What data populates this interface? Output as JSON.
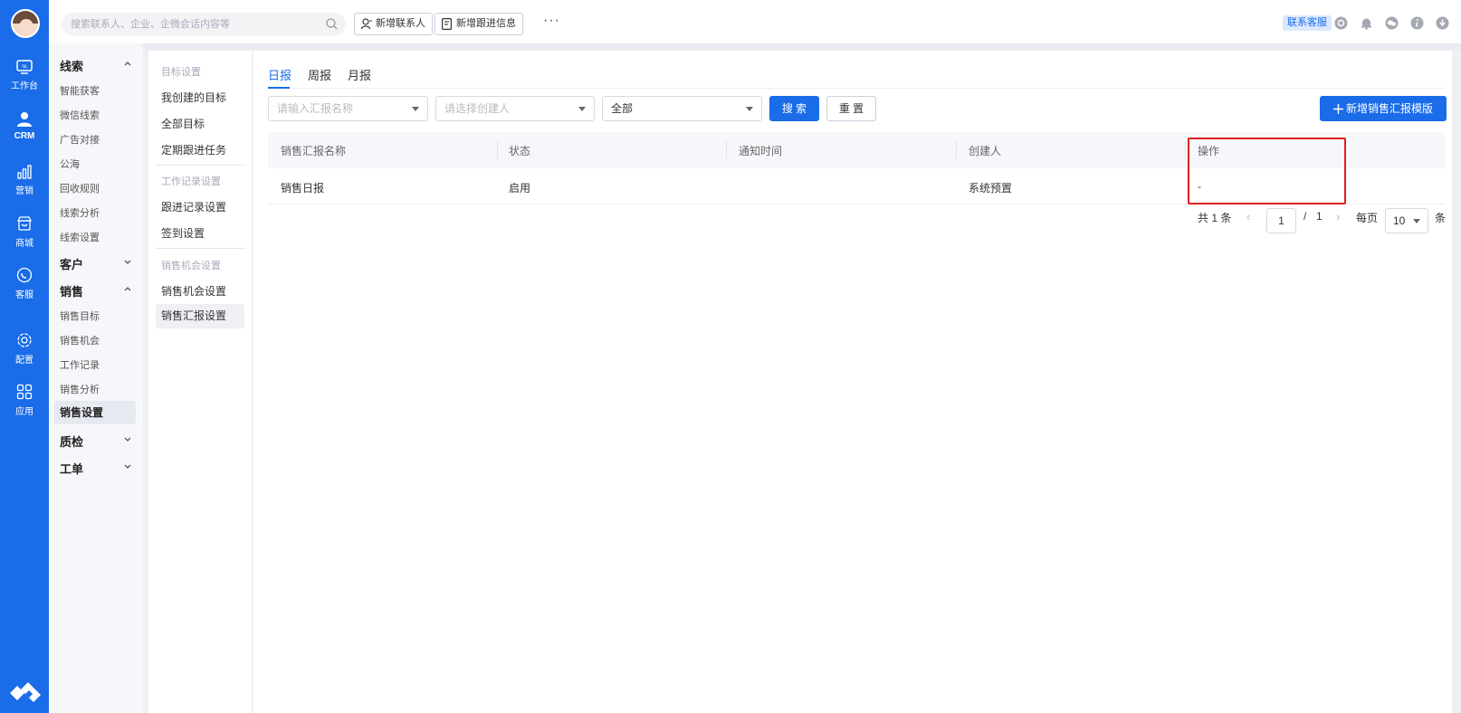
{
  "topbar": {
    "search_placeholder": "搜索联系人、企业、企微会话内容等",
    "new_contact": "新增联系人",
    "new_followup": "新增跟进信息",
    "more": "···",
    "customer_service": "联系客服"
  },
  "rail": {
    "items": [
      {
        "label": "工作台",
        "icon": "dashboard-icon"
      },
      {
        "label": "CRM",
        "icon": "person-icon"
      },
      {
        "label": "营销",
        "icon": "chart-icon"
      },
      {
        "label": "商城",
        "icon": "store-icon"
      },
      {
        "label": "客服",
        "icon": "chat-icon"
      },
      {
        "label": "配置",
        "icon": "gear-icon"
      },
      {
        "label": "应用",
        "icon": "apps-icon"
      }
    ]
  },
  "nav": {
    "group_leads": "线索",
    "leads_items": [
      "智能获客",
      "微信线索",
      "广告对接",
      "公海",
      "回收规则",
      "线索分析",
      "线索设置"
    ],
    "group_customer": "客户",
    "group_sales": "销售",
    "sales_items": [
      "销售目标",
      "销售机会",
      "工作记录",
      "销售分析"
    ],
    "sales_active": "销售设置",
    "group_qc": "质检",
    "group_ticket": "工单"
  },
  "panel3": {
    "head_goal": "目标设置",
    "goal_items": [
      "我创建的目标",
      "全部目标",
      "定期跟进任务"
    ],
    "head_work": "工作记录设置",
    "work_items": [
      "跟进记录设置",
      "签到设置"
    ],
    "head_opportunity": "销售机会设置",
    "opp_item": "销售机会设置",
    "active": "销售汇报设置"
  },
  "main": {
    "tabs": [
      "日报",
      "周报",
      "月报"
    ],
    "filters": {
      "name_placeholder": "请输入汇报名称",
      "creator_placeholder": "请选择创建人",
      "status_value": "全部",
      "search": "搜 索",
      "reset": "重 置"
    },
    "add_button": "新增销售汇报模版",
    "columns": [
      "销售汇报名称",
      "状态",
      "通知时间",
      "创建人",
      "操作"
    ],
    "rows": [
      {
        "name": "销售日报",
        "status": "启用",
        "notify": "",
        "creator": "系统预置",
        "action": "-"
      }
    ],
    "pager": {
      "total": "共 1 条",
      "page": "1",
      "slash": "/",
      "pages": "1",
      "per_page_label": "每页",
      "per_page": "10",
      "unit": "条"
    }
  },
  "colors": {
    "accent": "#1a6ce8",
    "highlight": "#e02020"
  }
}
